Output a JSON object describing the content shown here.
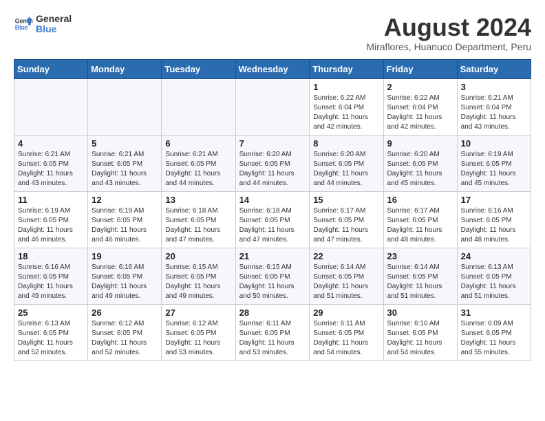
{
  "header": {
    "logo_line1": "General",
    "logo_line2": "Blue",
    "month": "August 2024",
    "location": "Miraflores, Huanuco Department, Peru"
  },
  "days_of_week": [
    "Sunday",
    "Monday",
    "Tuesday",
    "Wednesday",
    "Thursday",
    "Friday",
    "Saturday"
  ],
  "weeks": [
    [
      {
        "day": "",
        "info": ""
      },
      {
        "day": "",
        "info": ""
      },
      {
        "day": "",
        "info": ""
      },
      {
        "day": "",
        "info": ""
      },
      {
        "day": "1",
        "info": "Sunrise: 6:22 AM\nSunset: 6:04 PM\nDaylight: 11 hours and 42 minutes."
      },
      {
        "day": "2",
        "info": "Sunrise: 6:22 AM\nSunset: 6:04 PM\nDaylight: 11 hours and 42 minutes."
      },
      {
        "day": "3",
        "info": "Sunrise: 6:21 AM\nSunset: 6:04 PM\nDaylight: 11 hours and 43 minutes."
      }
    ],
    [
      {
        "day": "4",
        "info": "Sunrise: 6:21 AM\nSunset: 6:05 PM\nDaylight: 11 hours and 43 minutes."
      },
      {
        "day": "5",
        "info": "Sunrise: 6:21 AM\nSunset: 6:05 PM\nDaylight: 11 hours and 43 minutes."
      },
      {
        "day": "6",
        "info": "Sunrise: 6:21 AM\nSunset: 6:05 PM\nDaylight: 11 hours and 44 minutes."
      },
      {
        "day": "7",
        "info": "Sunrise: 6:20 AM\nSunset: 6:05 PM\nDaylight: 11 hours and 44 minutes."
      },
      {
        "day": "8",
        "info": "Sunrise: 6:20 AM\nSunset: 6:05 PM\nDaylight: 11 hours and 44 minutes."
      },
      {
        "day": "9",
        "info": "Sunrise: 6:20 AM\nSunset: 6:05 PM\nDaylight: 11 hours and 45 minutes."
      },
      {
        "day": "10",
        "info": "Sunrise: 6:19 AM\nSunset: 6:05 PM\nDaylight: 11 hours and 45 minutes."
      }
    ],
    [
      {
        "day": "11",
        "info": "Sunrise: 6:19 AM\nSunset: 6:05 PM\nDaylight: 11 hours and 46 minutes."
      },
      {
        "day": "12",
        "info": "Sunrise: 6:19 AM\nSunset: 6:05 PM\nDaylight: 11 hours and 46 minutes."
      },
      {
        "day": "13",
        "info": "Sunrise: 6:18 AM\nSunset: 6:05 PM\nDaylight: 11 hours and 47 minutes."
      },
      {
        "day": "14",
        "info": "Sunrise: 6:18 AM\nSunset: 6:05 PM\nDaylight: 11 hours and 47 minutes."
      },
      {
        "day": "15",
        "info": "Sunrise: 6:17 AM\nSunset: 6:05 PM\nDaylight: 11 hours and 47 minutes."
      },
      {
        "day": "16",
        "info": "Sunrise: 6:17 AM\nSunset: 6:05 PM\nDaylight: 11 hours and 48 minutes."
      },
      {
        "day": "17",
        "info": "Sunrise: 6:16 AM\nSunset: 6:05 PM\nDaylight: 11 hours and 48 minutes."
      }
    ],
    [
      {
        "day": "18",
        "info": "Sunrise: 6:16 AM\nSunset: 6:05 PM\nDaylight: 11 hours and 49 minutes."
      },
      {
        "day": "19",
        "info": "Sunrise: 6:16 AM\nSunset: 6:05 PM\nDaylight: 11 hours and 49 minutes."
      },
      {
        "day": "20",
        "info": "Sunrise: 6:15 AM\nSunset: 6:05 PM\nDaylight: 11 hours and 49 minutes."
      },
      {
        "day": "21",
        "info": "Sunrise: 6:15 AM\nSunset: 6:05 PM\nDaylight: 11 hours and 50 minutes."
      },
      {
        "day": "22",
        "info": "Sunrise: 6:14 AM\nSunset: 6:05 PM\nDaylight: 11 hours and 51 minutes."
      },
      {
        "day": "23",
        "info": "Sunrise: 6:14 AM\nSunset: 6:05 PM\nDaylight: 11 hours and 51 minutes."
      },
      {
        "day": "24",
        "info": "Sunrise: 6:13 AM\nSunset: 6:05 PM\nDaylight: 11 hours and 51 minutes."
      }
    ],
    [
      {
        "day": "25",
        "info": "Sunrise: 6:13 AM\nSunset: 6:05 PM\nDaylight: 11 hours and 52 minutes."
      },
      {
        "day": "26",
        "info": "Sunrise: 6:12 AM\nSunset: 6:05 PM\nDaylight: 11 hours and 52 minutes."
      },
      {
        "day": "27",
        "info": "Sunrise: 6:12 AM\nSunset: 6:05 PM\nDaylight: 11 hours and 53 minutes."
      },
      {
        "day": "28",
        "info": "Sunrise: 6:11 AM\nSunset: 6:05 PM\nDaylight: 11 hours and 53 minutes."
      },
      {
        "day": "29",
        "info": "Sunrise: 6:11 AM\nSunset: 6:05 PM\nDaylight: 11 hours and 54 minutes."
      },
      {
        "day": "30",
        "info": "Sunrise: 6:10 AM\nSunset: 6:05 PM\nDaylight: 11 hours and 54 minutes."
      },
      {
        "day": "31",
        "info": "Sunrise: 6:09 AM\nSunset: 6:05 PM\nDaylight: 11 hours and 55 minutes."
      }
    ]
  ]
}
